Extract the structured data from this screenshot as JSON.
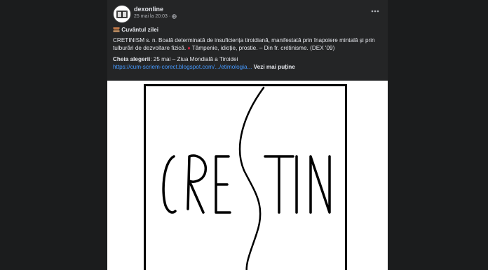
{
  "post": {
    "author": "dexonline",
    "time": "25 mai la 20:03",
    "separator": "·",
    "privacy_icon": "globe-icon",
    "more_icon": "more-options-icon",
    "title_icon": "book-stack-icon",
    "title": "Cuvântul zilei",
    "definition": "CRETINISM s. n. Boală determinată de insuficiența tiroidiană, manifestată prin înapoiere mintală și prin tulburări de dezvoltare fizică.",
    "diamond_icon": "red-diamond-icon",
    "figurative": "Tâmpenie, idioție, prostie. – Din fr. crétinisme. (DEX '09)",
    "choice_label": "Cheia alegerii",
    "choice_text": ": 25 mai – Ziua Mondială a Tiroidei",
    "link": "https://cum-scriem-corect.blogspot.com/.../etimologia...",
    "see_more": "Vezi mai puține"
  },
  "image": {
    "letters_left": "CRE",
    "letters_right": "TIN",
    "accent_color": "#4599ff"
  }
}
